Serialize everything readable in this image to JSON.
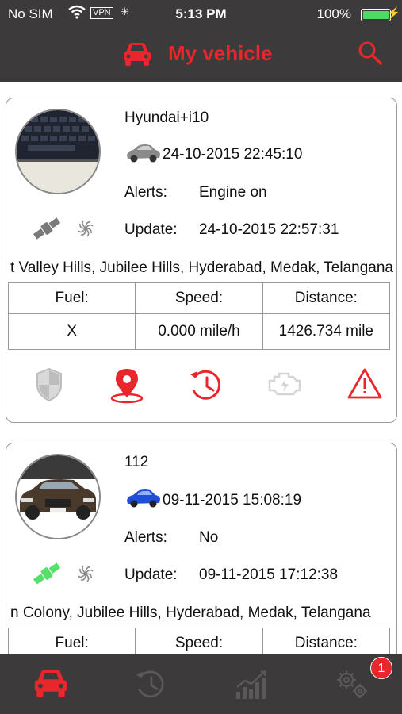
{
  "status_bar": {
    "carrier": "No SIM",
    "vpn": "VPN",
    "time": "5:13 PM",
    "battery": "100%",
    "battery_level": 1.0
  },
  "header": {
    "title": "My vehicle",
    "icons": [
      "car-icon",
      "search-icon"
    ]
  },
  "vehicles": [
    {
      "name": "Hyundai+i10",
      "last_time": "24-10-2015 22:45:10",
      "alerts_label": "Alerts:",
      "alerts_value": "Engine on",
      "update_label": "Update:",
      "update_value": "24-10-2015 22:57:31",
      "address": "t Valley Hills, Jubilee Hills, Hyderabad, Medak, Telangana",
      "table": {
        "headers": [
          "Fuel:",
          "Speed:",
          "Distance:"
        ],
        "values": [
          "X",
          "0.000 mile/h",
          "1426.734 mile"
        ]
      },
      "actions": [
        "shield-icon",
        "location-pin-icon",
        "history-icon",
        "engine-icon",
        "warning-icon"
      ]
    },
    {
      "name": "112",
      "last_time": "09-11-2015 15:08:19",
      "alerts_label": "Alerts:",
      "alerts_value": "No",
      "update_label": "Update:",
      "update_value": "09-11-2015 17:12:38",
      "address": "n Colony, Jubilee Hills, Hyderabad, Medak, Telangana",
      "table": {
        "headers": [
          "Fuel:",
          "Speed:",
          "Distance:"
        ]
      }
    }
  ],
  "tab_bar": {
    "tabs": [
      "car-tab-icon",
      "history-tab-icon",
      "statistics-tab-icon",
      "settings-tab-icon"
    ],
    "settings_badge": "1"
  },
  "colors": {
    "accent": "#e8262c",
    "bar": "#3c3a3a",
    "satellite_online": "#55e06a",
    "satellite_offline": "#7a7a7a"
  }
}
